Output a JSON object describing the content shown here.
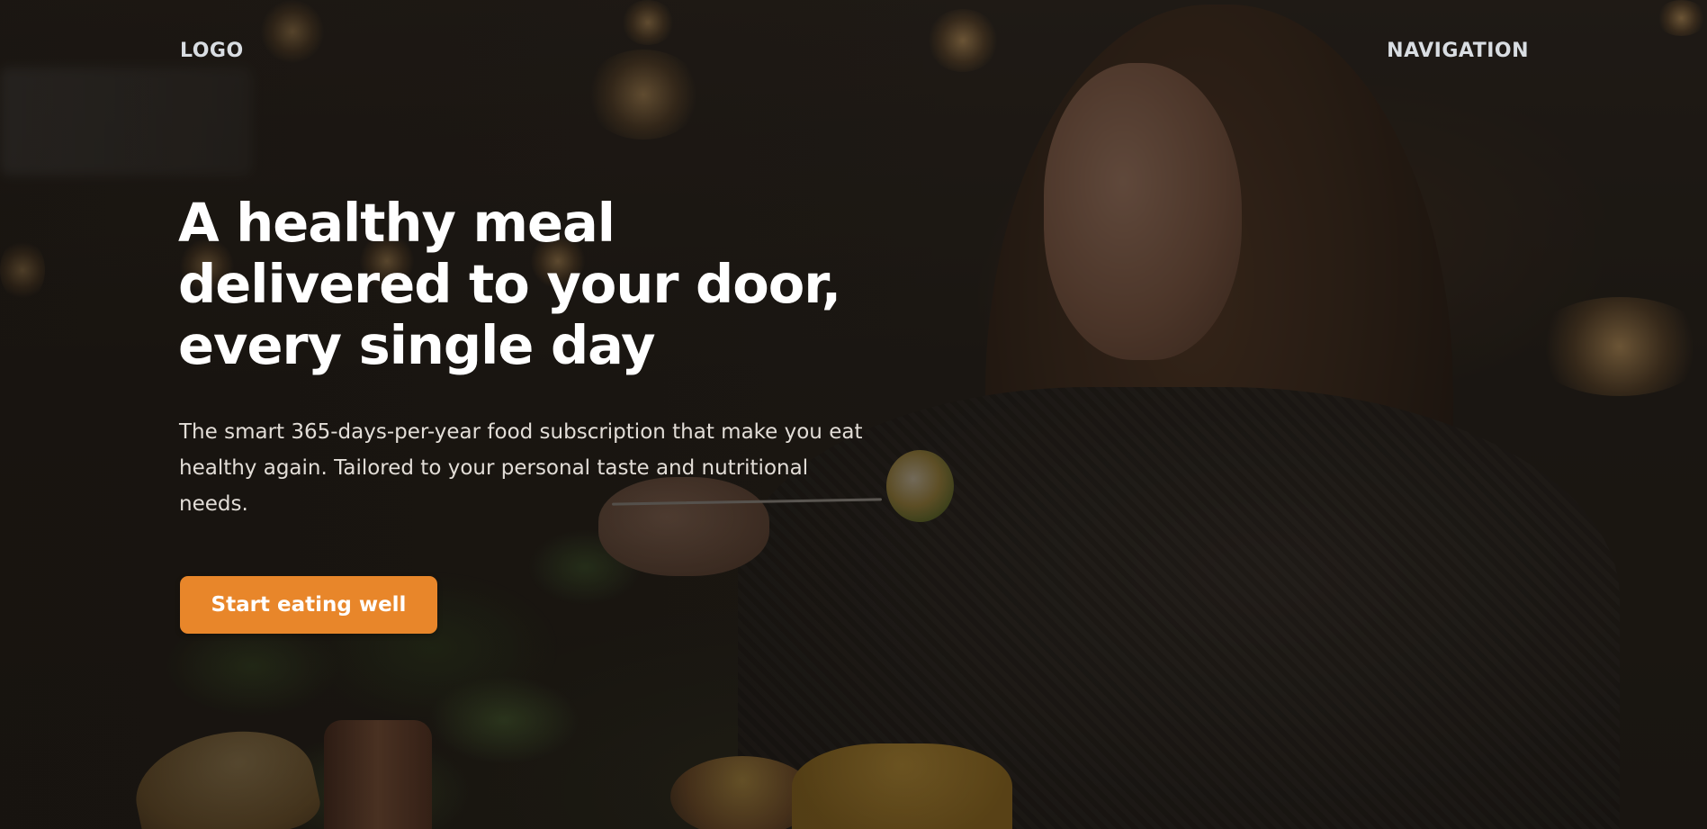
{
  "header": {
    "logo_label": "LOGO",
    "navigation_label": "NAVIGATION"
  },
  "hero": {
    "headline": "A healthy meal delivered to your door, every single day",
    "description": "The smart 365-days-per-year food subscription that make you eat healthy again. Tailored to your personal taste and nutritional needs.",
    "cta_label": "Start eating well",
    "background_image": "woman-eating-pasta-photo"
  },
  "colors": {
    "accent": "#e8862a",
    "heading_text": "#ffffff",
    "body_text": "#e2ddd7",
    "header_text": "#d9dde2"
  }
}
